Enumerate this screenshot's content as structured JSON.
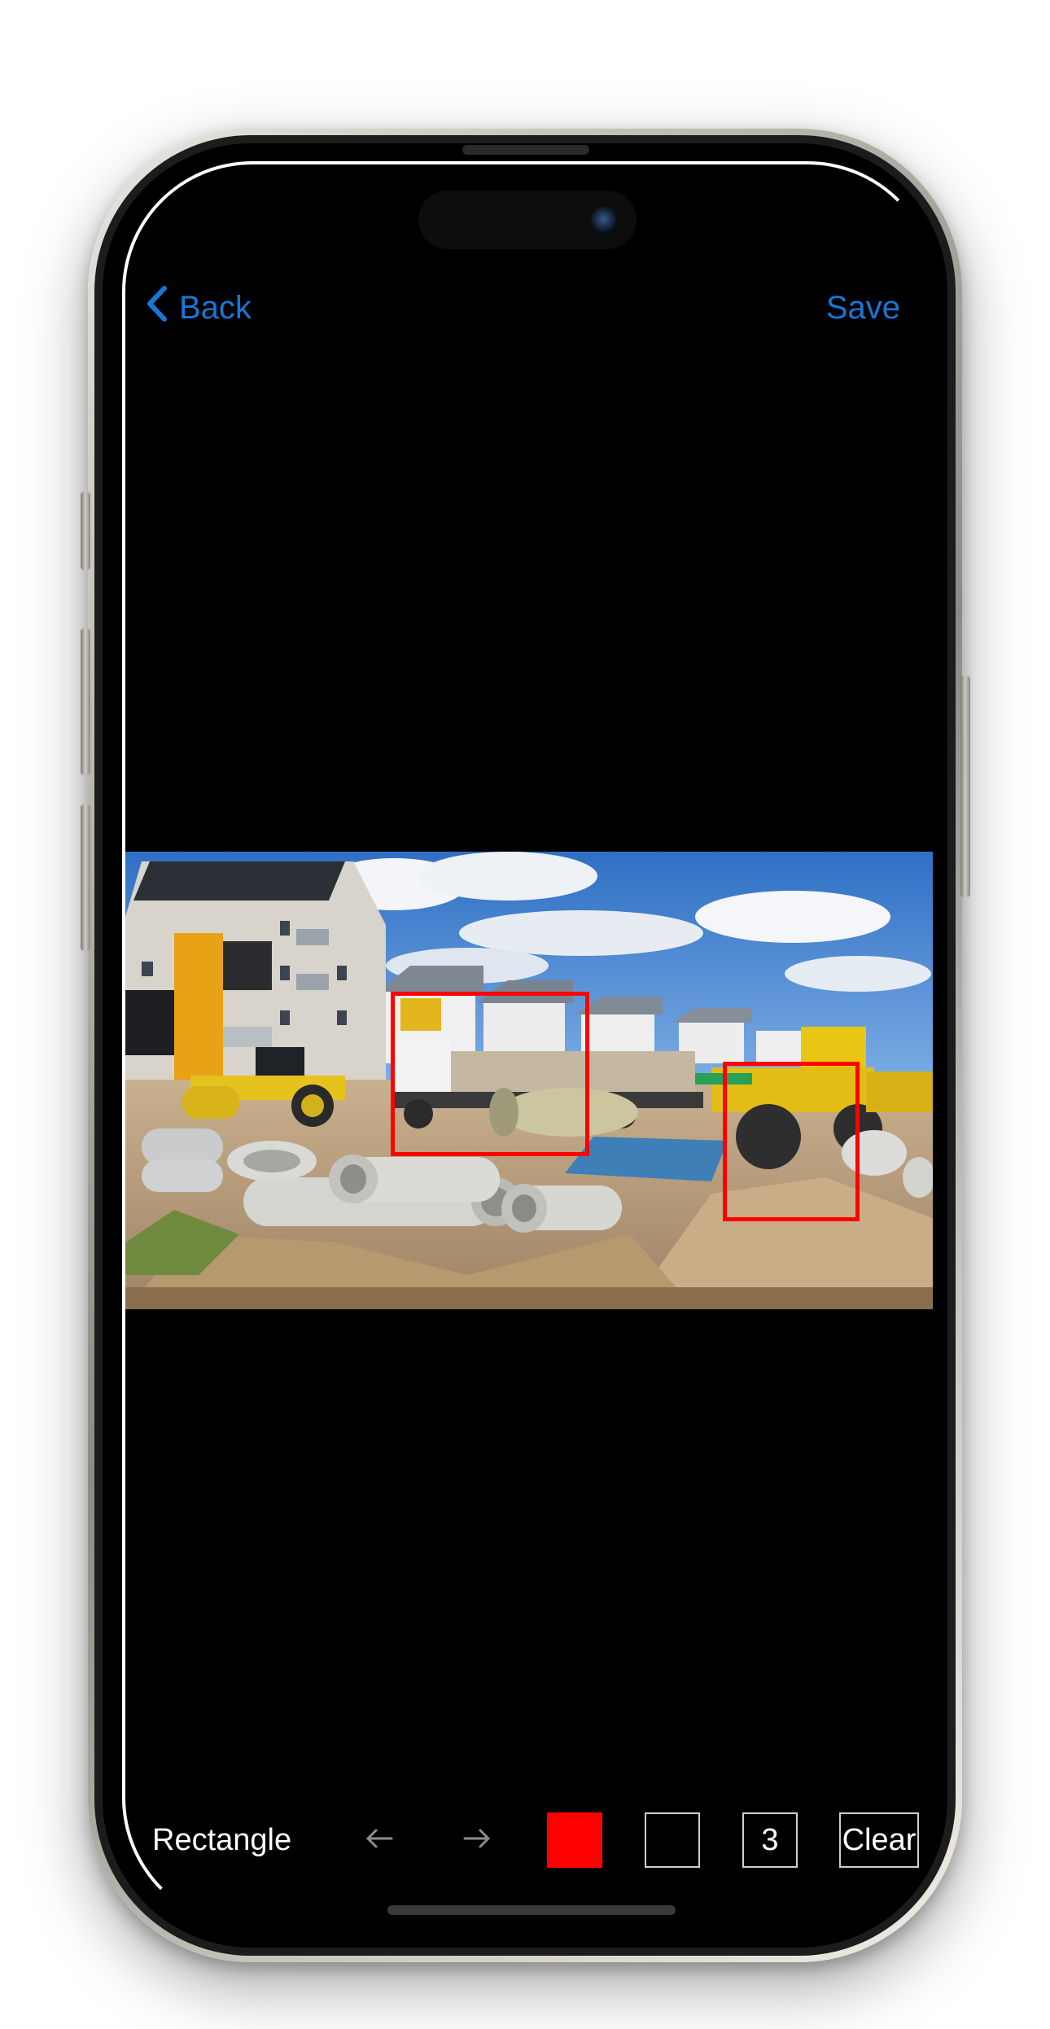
{
  "nav": {
    "back_label": "Back",
    "save_label": "Save"
  },
  "toolbar": {
    "tool_label": "Rectangle",
    "stroke_color": "#ff0000",
    "fill_color": "#000000",
    "line_width": "3",
    "clear_label": "Clear"
  },
  "colors": {
    "accent": "#1677d8",
    "annotation": "#ff0000",
    "background": "#000000"
  },
  "icons": {
    "back": "chevron-left-icon",
    "undo": "arrow-left-icon",
    "redo": "arrow-right-icon"
  },
  "photo": {
    "subject": "construction-site-photo",
    "annotation_count": 2
  }
}
